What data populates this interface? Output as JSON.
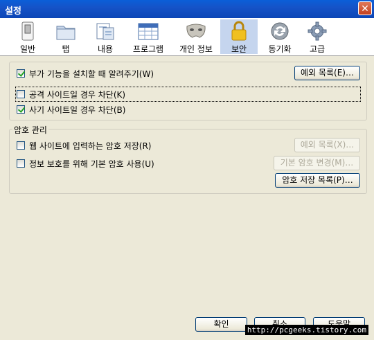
{
  "window": {
    "title": "설정",
    "close_symbol": "✕"
  },
  "toolbar": {
    "items": [
      {
        "label": "일반",
        "icon": "switch-icon"
      },
      {
        "label": "탭",
        "icon": "folder-tabs-icon"
      },
      {
        "label": "내용",
        "icon": "document-content-icon"
      },
      {
        "label": "프로그램",
        "icon": "calendar-applications-icon"
      },
      {
        "label": "개인 정보",
        "icon": "mask-icon"
      },
      {
        "label": "보안",
        "icon": "padlock-icon"
      },
      {
        "label": "동기화",
        "icon": "sync-icon"
      },
      {
        "label": "고급",
        "icon": "gear-icon"
      }
    ],
    "selected": "보안"
  },
  "security": {
    "addons_warn": {
      "label": "부가 기능을 설치할 때 알려주기(W)",
      "checked": true
    },
    "addons_exceptions_button": "예외 목록(E)…",
    "block_attack": {
      "label": "공격 사이트일 경우 차단(K)",
      "checked": false
    },
    "block_forgery": {
      "label": "사기 사이트일 경우 차단(B)",
      "checked": true
    }
  },
  "passwords": {
    "legend": "암호 관리",
    "remember": {
      "label": "웹 사이트에 입력하는 암호 저장(R)",
      "checked": false
    },
    "exceptions_button": "예외 목록(X)…",
    "master": {
      "label": "정보 보호를 위해 기본 암호 사용(U)",
      "checked": false
    },
    "change_master_button": "기본 암호 변경(M)…",
    "saved_passwords_button": "암호 저장 목록(P)…"
  },
  "footer": {
    "ok": "확인",
    "cancel": "취소",
    "help": "도움말",
    "watermark": "http://pcgeeks.tistory.com"
  },
  "colors": {
    "titlebar": "#0c46b6",
    "dialog_bg": "#ece9d8",
    "selected_tab": "#c5d5ee"
  }
}
